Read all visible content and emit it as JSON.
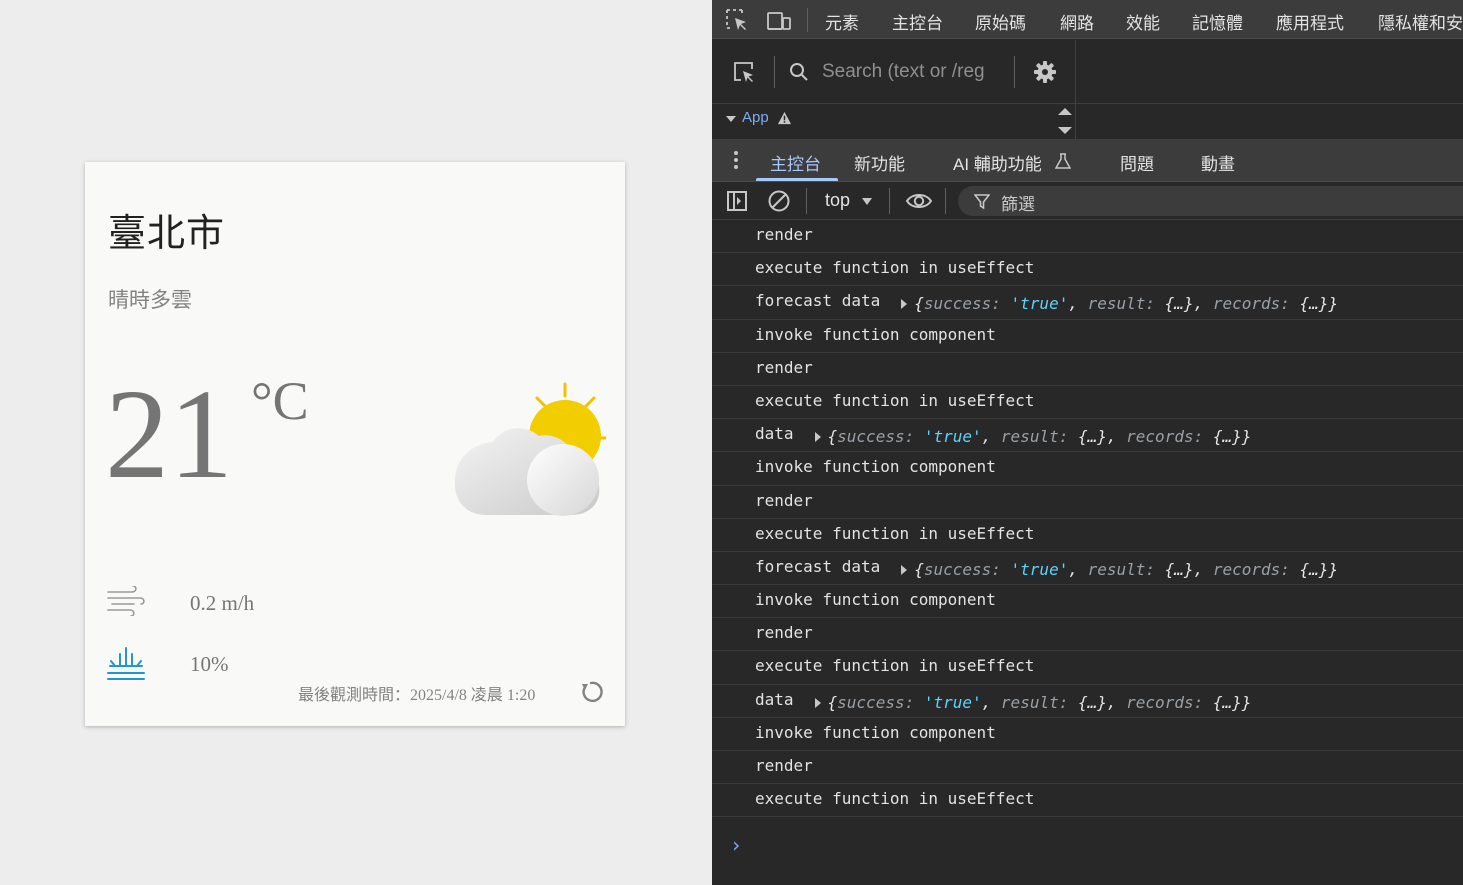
{
  "weather": {
    "city": "臺北市",
    "description": "晴時多雲",
    "temperature": "21",
    "unit": "°C",
    "wind": "0.2 m/h",
    "rain": "10%",
    "observation": "最後觀測時間：2025/4/8 凌晨 1:20",
    "icon": "day-partly-cloudy-icon"
  },
  "devtools": {
    "tabs": [
      "元素",
      "主控台",
      "原始碼",
      "網路",
      "效能",
      "記憶體",
      "應用程式",
      "隱私權和安"
    ],
    "search_placeholder": "Search (text or /reg",
    "dom_node": "App",
    "drawer_tabs": [
      "主控台",
      "新功能",
      "AI 輔助功能",
      "問題",
      "動畫"
    ],
    "context": "top",
    "filter_placeholder": "篩選",
    "colors": {
      "accent": "#a8c7fa",
      "string": "#5cd5fb"
    }
  },
  "console": {
    "rows": [
      {
        "text": "render"
      },
      {
        "text": "execute function in useEffect"
      },
      {
        "text": "forecast data",
        "obj": {
          "success": "'true'",
          "result": "{…}",
          "records": "{…}"
        }
      },
      {
        "text": "invoke function component"
      },
      {
        "text": "render"
      },
      {
        "text": "execute function in useEffect"
      },
      {
        "text": "data",
        "obj": {
          "success": "'true'",
          "result": "{…}",
          "records": "{…}"
        }
      },
      {
        "text": "invoke function component"
      },
      {
        "text": "render"
      },
      {
        "text": "execute function in useEffect"
      },
      {
        "text": "forecast data",
        "obj": {
          "success": "'true'",
          "result": "{…}",
          "records": "{…}"
        }
      },
      {
        "text": "invoke function component"
      },
      {
        "text": "render"
      },
      {
        "text": "execute function in useEffect"
      },
      {
        "text": "data",
        "obj": {
          "success": "'true'",
          "result": "{…}",
          "records": "{…}"
        }
      },
      {
        "text": "invoke function component"
      },
      {
        "text": "render"
      },
      {
        "text": "execute function in useEffect"
      }
    ]
  }
}
